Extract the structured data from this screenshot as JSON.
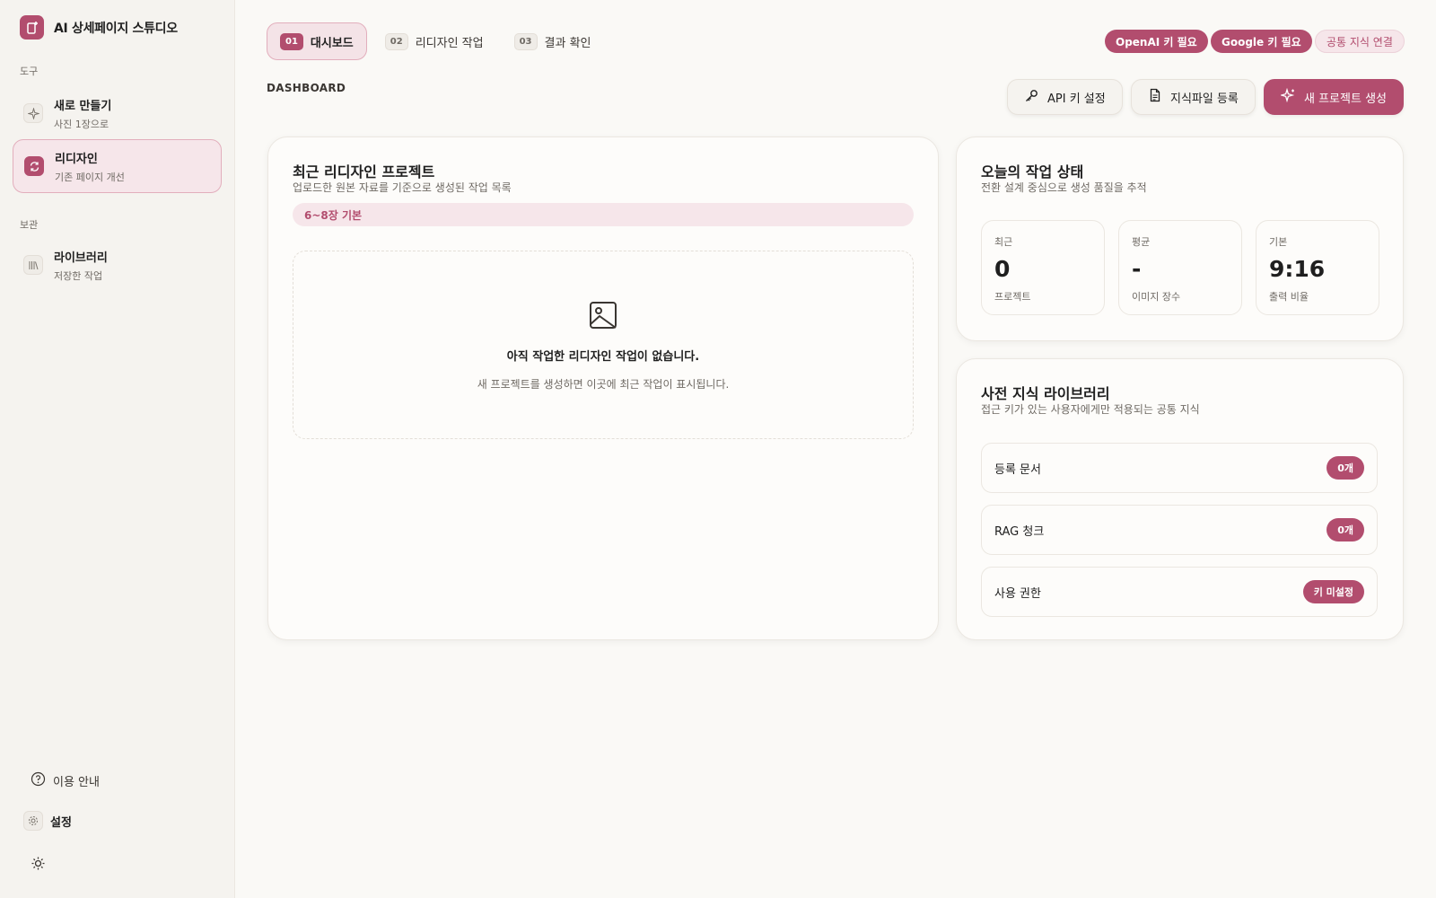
{
  "brand": {
    "name": "AI 상세페이지 스튜디오",
    "icon": "phone-plus-icon"
  },
  "sidebar": {
    "section_tools": "도구",
    "section_archive": "보관",
    "items": [
      {
        "title": "새로 만들기",
        "sub": "사진 1장으로",
        "icon": "sparkle-icon",
        "active": false
      },
      {
        "title": "리디자인",
        "sub": "기존 페이지 개선",
        "icon": "refresh-icon",
        "active": true
      },
      {
        "title": "라이브러리",
        "sub": "저장한 작업",
        "icon": "library-icon",
        "active": false
      }
    ],
    "footer": {
      "help": "이용 안내",
      "settings": "설정"
    }
  },
  "tabs": [
    {
      "num": "01",
      "label": "대시보드",
      "active": true
    },
    {
      "num": "02",
      "label": "리디자인 작업",
      "active": false
    },
    {
      "num": "03",
      "label": "결과 확인",
      "active": false
    }
  ],
  "status_pills": {
    "openai": "OpenAI 키 필요",
    "google": "Google 키 필요",
    "knowledge": "공통 지식 연결"
  },
  "breadcrumb": "DASHBOARD",
  "actions": {
    "api_key": "API 키 설정",
    "knowledge_file": "지식파일 등록",
    "new_project": "새 프로젝트 생성"
  },
  "recent": {
    "title": "최근 리디자인 프로젝트",
    "subtitle": "업로드한 원본 자료를 기준으로 생성된 작업 목록",
    "tag": "6~8장 기본",
    "empty_title": "아직 작업한 리디자인 작업이 없습니다.",
    "empty_sub": "새 프로젝트를 생성하면 이곳에 최근 작업이 표시됩니다."
  },
  "today": {
    "title": "오늘의 작업 상태",
    "subtitle": "전환 설계 중심으로 생성 품질을 추적",
    "stats": [
      {
        "label": "최근",
        "value": "0",
        "note": "프로젝트"
      },
      {
        "label": "평균",
        "value": "-",
        "note": "이미지 장수"
      },
      {
        "label": "기본",
        "value": "9:16",
        "note": "출력 비율"
      }
    ]
  },
  "library": {
    "title": "사전 지식 라이브러리",
    "subtitle": "접근 키가 있는 사용자에게만 적용되는 공통 지식",
    "rows": [
      {
        "label": "등록 문서",
        "badge": "0개"
      },
      {
        "label": "RAG 청크",
        "badge": "0개"
      },
      {
        "label": "사용 권한",
        "badge": "키 미설정"
      }
    ]
  },
  "colors": {
    "accent": "#b24d6e",
    "accent_soft": "#f6e6ea",
    "background": "#faf9f6"
  }
}
